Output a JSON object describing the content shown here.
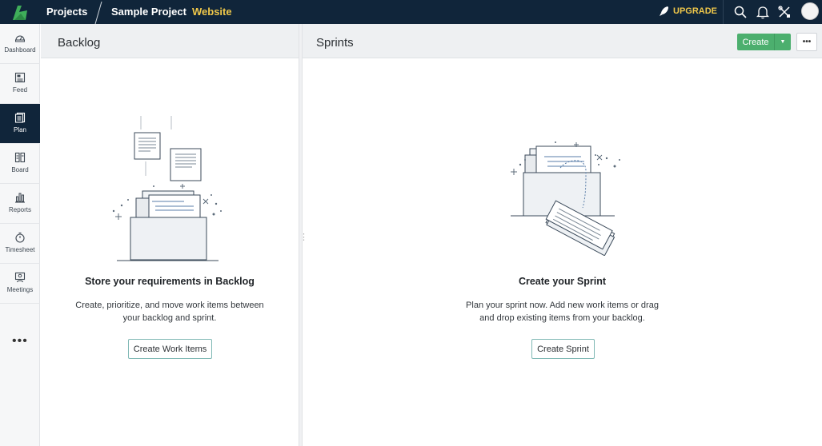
{
  "topbar": {
    "projects_label": "Projects",
    "project_name": "Sample Project",
    "current_view": "Website",
    "upgrade_label": "UPGRADE",
    "icons": [
      "search-icon",
      "bell-icon",
      "tools-icon"
    ]
  },
  "sidebar": {
    "items": [
      {
        "label": "Dashboard",
        "icon": "dashboard-icon"
      },
      {
        "label": "Feed",
        "icon": "feed-icon"
      },
      {
        "label": "Plan",
        "icon": "plan-icon",
        "active": true
      },
      {
        "label": "Board",
        "icon": "board-icon"
      },
      {
        "label": "Reports",
        "icon": "reports-icon"
      },
      {
        "label": "Timesheet",
        "icon": "timesheet-icon"
      },
      {
        "label": "Meetings",
        "icon": "meetings-icon"
      }
    ],
    "more_label": "•••"
  },
  "backlog": {
    "title": "Backlog",
    "empty_title": "Store your requirements in Backlog",
    "empty_desc_line1": "Create, prioritize, and move work items between",
    "empty_desc_line2": "your backlog and sprint.",
    "button_label": "Create Work Items"
  },
  "sprints": {
    "title": "Sprints",
    "create_label": "Create",
    "more_label": "•••",
    "empty_title": "Create your Sprint",
    "empty_desc_line1": "Plan your sprint now. Add new work items or drag",
    "empty_desc_line2": "and drop existing items from your backlog.",
    "button_label": "Create Sprint"
  },
  "colors": {
    "topbar_bg": "#10253a",
    "accent_yellow": "#f0c84a",
    "create_green": "#4caf6e",
    "nav_active": "#10253a"
  }
}
